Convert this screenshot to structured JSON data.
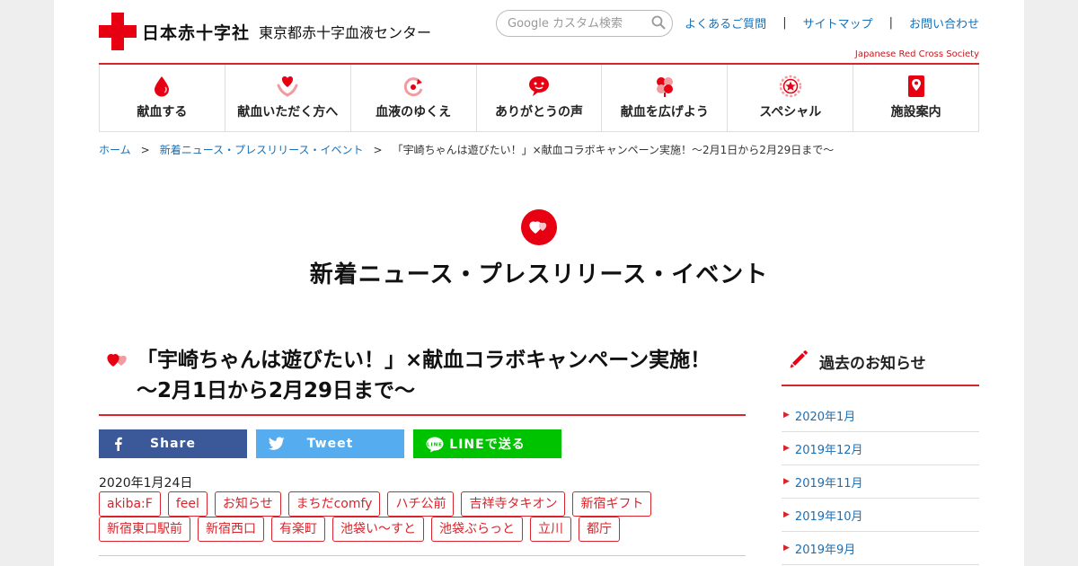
{
  "header": {
    "org_name": "日本赤十字社",
    "center_name": "東京都赤十字血液センター",
    "org_name_en": "Japanese Red Cross Society",
    "search_placeholder": "Google カスタム検索",
    "links": [
      "よくあるご質問",
      "サイトマップ",
      "お問い合わせ"
    ]
  },
  "nav": [
    {
      "label": "献血する",
      "icon": "blood-drop-icon"
    },
    {
      "label": "献血いただく方へ",
      "icon": "heart-hands-icon"
    },
    {
      "label": "血液のゆくえ",
      "icon": "cycle-arrow-icon"
    },
    {
      "label": "ありがとうの声",
      "icon": "speech-bubble-icon"
    },
    {
      "label": "献血を広げよう",
      "icon": "clover-icon"
    },
    {
      "label": "スペシャル",
      "icon": "star-badge-icon"
    },
    {
      "label": "施設案内",
      "icon": "location-card-icon"
    }
  ],
  "breadcrumb": {
    "items": [
      "ホーム",
      "新着ニュース・プレスリリース・イベント",
      "「宇崎ちゃんは遊びたい！」×献血コラボキャンペーン実施！～2月1日から2月29日まで～"
    ],
    "separator": ">"
  },
  "page_title": "新着ニュース・プレスリリース・イベント",
  "article": {
    "title": "「宇崎ちゃんは遊びたい！」×献血コラボキャンペーン実施！～2月1日から2月29日まで～",
    "date": "2020年1月24日",
    "share": {
      "facebook": "Share",
      "twitter": "Tweet",
      "line": "LINEで送る"
    },
    "tags_row1": [
      "akiba:F",
      "feel",
      "お知らせ",
      "まちだcomfy",
      "ハチ公前",
      "吉祥寺タキオン",
      "新宿ギフト"
    ],
    "tags_row2": [
      "新宿東口駅前",
      "新宿西口",
      "有楽町",
      "池袋い～すと",
      "池袋ぶらっと",
      "立川",
      "都庁"
    ]
  },
  "sidebar": {
    "title": "過去のお知らせ",
    "archive": [
      "2020年1月",
      "2019年12月",
      "2019年11月",
      "2019年10月",
      "2019年9月"
    ]
  },
  "colors": {
    "brand_red": "#e60012",
    "link_blue": "#1a6fb5",
    "facebook": "#3b5998",
    "twitter": "#55acee",
    "line": "#00c300"
  }
}
